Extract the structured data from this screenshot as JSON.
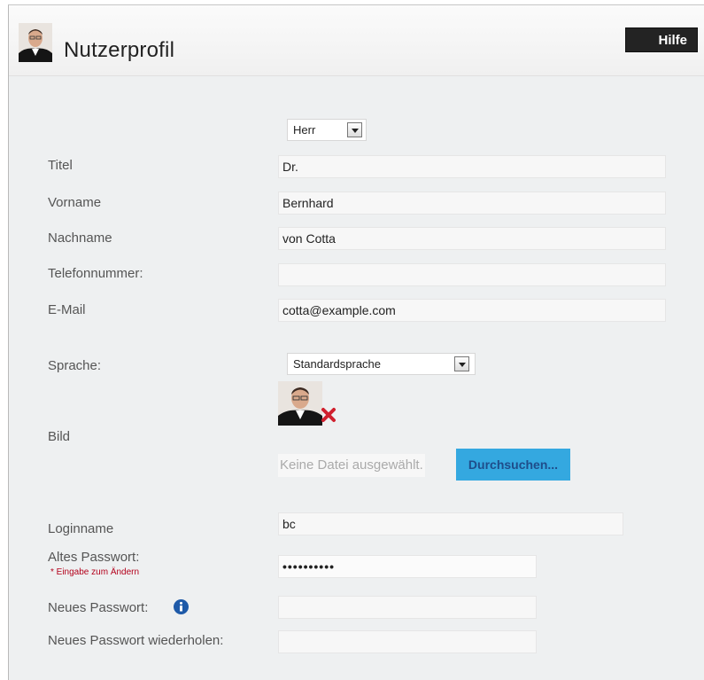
{
  "header": {
    "title": "Nutzerprofil",
    "help_label": "Hilfe"
  },
  "form": {
    "salutation": {
      "value": "Herr"
    },
    "title": {
      "label": "Titel",
      "value": "Dr."
    },
    "first_name": {
      "label": "Vorname",
      "value": "Bernhard"
    },
    "last_name": {
      "label": "Nachname",
      "value": "von Cotta"
    },
    "phone": {
      "label": "Telefonnummer:",
      "value": ""
    },
    "email": {
      "label": "E-Mail",
      "value": "cotta@example.com"
    },
    "language": {
      "label": "Sprache:",
      "value": "Standardsprache"
    },
    "picture": {
      "label": "Bild",
      "file_status": "Keine Datei ausgewählt.",
      "browse_label": "Durchsuchen..."
    },
    "login_name": {
      "label": "Loginname",
      "value": "bc"
    },
    "old_password": {
      "label": "Altes Passwort:",
      "value": "••••••••••",
      "hint": "* Eingabe zum Ändern"
    },
    "new_password": {
      "label": "Neues Passwort:",
      "value": ""
    },
    "repeat_password": {
      "label": "Neues Passwort wiederholen:",
      "value": ""
    }
  },
  "colors": {
    "accent": "#34a8e0",
    "help_button": "#232323",
    "hint": "#b3001b",
    "delete": "#d0202e"
  }
}
